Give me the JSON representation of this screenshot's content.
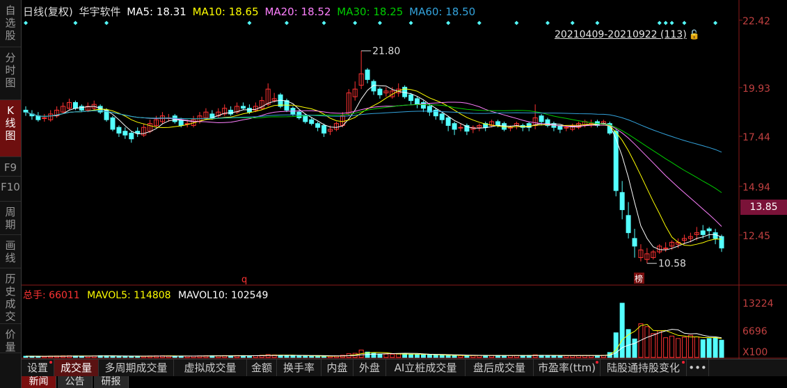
{
  "side_tabs": [
    {
      "label": "自\n选\n股",
      "active": false
    },
    {
      "label": "分\n时\n图",
      "active": false
    },
    {
      "label": "K\n线\n图",
      "active": true
    },
    {
      "label": "F9",
      "active": false
    },
    {
      "label": "F10",
      "active": false
    },
    {
      "label": "周\n期",
      "active": false
    },
    {
      "label": "画\n线",
      "active": false
    },
    {
      "label": "历\n史\n成\n交",
      "active": false
    },
    {
      "label": "价\n量",
      "active": false
    }
  ],
  "legend": {
    "period": "日线(复权)",
    "name": "华宇软件",
    "ma5": "MA5: 18.31",
    "ma10": "MA10: 18.65",
    "ma20": "MA20: 18.52",
    "ma30": "MA30: 18.25",
    "ma60": "MA60: 18.50"
  },
  "colors": {
    "up": "#ff3333",
    "down": "#54ffff",
    "ma5": "#ffffff",
    "ma10": "#ffff00",
    "ma20": "#ff80ff",
    "ma30": "#00cc00",
    "ma60": "#33a3dc"
  },
  "range_label": "20210409-20210922 (113)",
  "price_axis": [
    "22.42",
    "19.93",
    "17.44",
    "14.94",
    "12.45"
  ],
  "current_price": "13.85",
  "annotations": {
    "high": "21.80",
    "low": "10.58",
    "marker_q": "q",
    "marker_bang": "榜"
  },
  "volume_legend": {
    "total": "总手: 66011",
    "mavol5": "MAVOL5: 114808",
    "mavol10": "MAVOL10: 102549"
  },
  "volume_axis": [
    "13224",
    "6696",
    "X100"
  ],
  "bottom_tabs": [
    {
      "label": "设置",
      "dot": true
    },
    {
      "label": "成交量",
      "active": true
    },
    {
      "label": "多周期成交量"
    },
    {
      "label": "虚拟成交量"
    },
    {
      "label": "金额"
    },
    {
      "label": "换手率"
    },
    {
      "label": "内盘"
    },
    {
      "label": "外盘"
    },
    {
      "label": "AI立桩成交量"
    },
    {
      "label": "盘后成交量"
    },
    {
      "label": "市盈率(ttm)",
      "dot": true
    },
    {
      "label": "陆股通持股变化",
      "dot": true
    },
    {
      "label": "•••"
    }
  ],
  "news_tabs": [
    {
      "label": "新闻",
      "active": true
    },
    {
      "label": "公告"
    },
    {
      "label": "研报"
    }
  ],
  "chart_data": {
    "type": "candlestick",
    "y_range": [
      10.0,
      23.0
    ],
    "x": [
      "0",
      "1",
      "2",
      "3",
      "4",
      "5",
      "6",
      "7",
      "8",
      "9",
      "10",
      "11",
      "12",
      "13",
      "14",
      "15",
      "16",
      "17",
      "18",
      "19",
      "20",
      "21",
      "22",
      "23",
      "24",
      "25",
      "26",
      "27",
      "28",
      "29",
      "30",
      "31",
      "32",
      "33",
      "34",
      "35",
      "36",
      "37",
      "38",
      "39",
      "40",
      "41",
      "42",
      "43",
      "44",
      "45",
      "46",
      "47",
      "48",
      "49",
      "50",
      "51",
      "52",
      "53",
      "54",
      "55",
      "56",
      "57",
      "58",
      "59",
      "60",
      "61",
      "62",
      "63",
      "64",
      "65",
      "66",
      "67",
      "68",
      "69",
      "70",
      "71",
      "72",
      "73",
      "74",
      "75",
      "76",
      "77",
      "78",
      "79",
      "80",
      "81",
      "82",
      "83",
      "84",
      "85",
      "86",
      "87",
      "88",
      "89",
      "90",
      "91",
      "92",
      "93",
      "94",
      "95",
      "96",
      "97",
      "98",
      "99",
      "100",
      "101",
      "102",
      "103",
      "104",
      "105",
      "106",
      "107",
      "108",
      "109",
      "110",
      "111",
      "112"
    ],
    "open": [
      18.7,
      18.5,
      18.4,
      18.3,
      18.2,
      18.4,
      18.6,
      18.8,
      19.1,
      18.9,
      18.7,
      18.8,
      18.9,
      18.7,
      18.3,
      17.8,
      17.6,
      17.5,
      17.6,
      17.4,
      17.6,
      17.9,
      18.1,
      18.3,
      18.4,
      18.2,
      18.0,
      17.9,
      18.1,
      18.3,
      18.5,
      18.4,
      18.5,
      18.7,
      18.6,
      18.9,
      18.8,
      18.7,
      18.8,
      19.0,
      19.2,
      19.5,
      19.2,
      18.8,
      18.6,
      18.4,
      18.2,
      18.0,
      17.9,
      17.6,
      17.7,
      17.9,
      18.5,
      19.4,
      20.0,
      20.8,
      20.2,
      19.8,
      19.6,
      19.4,
      19.6,
      19.9,
      19.5,
      19.3,
      19.1,
      18.9,
      18.7,
      18.5,
      18.3,
      18.0,
      17.8,
      17.9,
      17.7,
      17.8,
      18.0,
      17.9,
      18.1,
      18.0,
      17.8,
      17.9,
      17.9,
      18.0,
      17.9,
      18.4,
      18.2,
      18.0,
      17.9,
      17.8,
      17.7,
      17.8,
      17.9,
      18.0,
      18.1,
      18.0,
      18.0,
      17.6,
      14.4,
      13.2,
      12.0,
      11.0,
      10.9,
      11.0,
      11.3,
      11.5,
      11.6,
      11.7,
      11.9,
      12.0,
      12.2,
      12.4,
      12.5,
      12.3,
      12.1
    ],
    "close": [
      18.6,
      18.4,
      18.2,
      18.3,
      18.5,
      18.7,
      18.9,
      19.1,
      18.8,
      18.7,
      18.9,
      19.0,
      18.6,
      18.2,
      17.7,
      17.5,
      17.4,
      17.2,
      17.5,
      17.8,
      18.0,
      18.2,
      18.4,
      18.3,
      18.1,
      17.9,
      18.0,
      18.2,
      18.4,
      18.6,
      18.3,
      18.6,
      18.8,
      18.5,
      18.9,
      18.8,
      18.6,
      18.9,
      19.2,
      19.8,
      19.3,
      18.9,
      18.7,
      18.5,
      18.3,
      18.1,
      18.0,
      17.8,
      17.5,
      17.7,
      18.0,
      18.4,
      19.6,
      19.8,
      20.6,
      20.3,
      19.7,
      19.5,
      19.7,
      19.7,
      19.8,
      19.4,
      19.2,
      19.0,
      18.8,
      18.6,
      18.4,
      18.2,
      17.9,
      17.7,
      17.8,
      17.6,
      17.8,
      17.9,
      17.8,
      18.1,
      17.9,
      17.7,
      17.8,
      18.0,
      17.8,
      17.8,
      18.3,
      18.1,
      17.9,
      17.8,
      17.7,
      17.8,
      17.9,
      18.0,
      18.1,
      18.0,
      17.9,
      18.1,
      17.5,
      14.5,
      13.5,
      12.3,
      11.6,
      11.4,
      11.2,
      11.3,
      11.6,
      11.5,
      11.8,
      11.8,
      12.0,
      12.1,
      12.3,
      12.2,
      12.4,
      12.0,
      11.5
    ],
    "high": [
      18.9,
      18.7,
      18.6,
      18.5,
      18.7,
      18.9,
      19.1,
      19.3,
      19.2,
      19.0,
      19.1,
      19.2,
      19.0,
      18.8,
      18.4,
      17.9,
      17.8,
      17.6,
      17.8,
      18.0,
      18.2,
      18.4,
      18.6,
      18.5,
      18.5,
      18.3,
      18.2,
      18.4,
      18.6,
      18.8,
      18.7,
      18.8,
      19.0,
      18.9,
      19.1,
      19.1,
      19.0,
      19.1,
      19.4,
      20.1,
      19.6,
      19.6,
      19.3,
      18.9,
      18.7,
      18.5,
      18.3,
      18.1,
      18.0,
      17.9,
      18.1,
      18.6,
      19.8,
      20.2,
      21.8,
      20.9,
      20.3,
      19.9,
      19.9,
      19.9,
      20.1,
      20.0,
      19.6,
      19.4,
      19.2,
      19.0,
      18.8,
      18.6,
      18.4,
      18.1,
      18.0,
      18.0,
      17.9,
      18.0,
      18.1,
      18.2,
      18.2,
      18.1,
      17.9,
      18.1,
      18.0,
      18.1,
      19.0,
      18.5,
      18.3,
      18.1,
      17.9,
      17.9,
      18.0,
      18.1,
      18.2,
      18.2,
      18.2,
      18.2,
      18.1,
      17.7,
      15.0,
      13.9,
      12.5,
      11.7,
      11.5,
      11.4,
      11.7,
      11.8,
      11.9,
      12.0,
      12.2,
      12.3,
      12.6,
      12.7,
      12.6,
      12.5,
      12.2
    ],
    "low": [
      18.4,
      18.2,
      18.1,
      18.1,
      18.1,
      18.3,
      18.5,
      18.7,
      18.7,
      18.6,
      18.6,
      18.7,
      18.5,
      18.1,
      17.6,
      17.3,
      17.2,
      17.0,
      17.3,
      17.3,
      17.5,
      17.8,
      18.0,
      18.1,
      18.0,
      17.8,
      17.8,
      17.8,
      18.0,
      18.2,
      18.2,
      18.3,
      18.4,
      18.4,
      18.5,
      18.7,
      18.5,
      18.6,
      18.7,
      18.9,
      19.1,
      18.8,
      18.6,
      18.4,
      18.2,
      18.0,
      17.9,
      17.6,
      17.3,
      17.4,
      17.6,
      17.8,
      18.4,
      19.2,
      19.8,
      20.1,
      19.5,
      19.3,
      19.4,
      19.3,
      19.4,
      19.3,
      19.0,
      18.8,
      18.6,
      18.4,
      18.2,
      18.0,
      17.6,
      17.4,
      17.6,
      17.4,
      17.5,
      17.6,
      17.6,
      17.8,
      17.8,
      17.6,
      17.6,
      17.7,
      17.6,
      17.6,
      17.7,
      17.9,
      17.8,
      17.6,
      17.5,
      17.6,
      17.6,
      17.7,
      17.8,
      17.8,
      17.8,
      17.9,
      17.4,
      14.2,
      13.0,
      12.0,
      11.0,
      10.8,
      10.7,
      10.9,
      11.2,
      11.3,
      11.4,
      11.5,
      11.7,
      11.8,
      11.9,
      12.0,
      12.0,
      11.7,
      11.3
    ],
    "volume": [
      300,
      280,
      260,
      270,
      320,
      350,
      380,
      400,
      360,
      330,
      340,
      370,
      420,
      380,
      340,
      300,
      290,
      260,
      280,
      320,
      360,
      380,
      400,
      370,
      340,
      320,
      330,
      350,
      380,
      400,
      380,
      420,
      450,
      410,
      460,
      430,
      400,
      440,
      520,
      700,
      600,
      520,
      480,
      430,
      400,
      360,
      330,
      300,
      280,
      310,
      380,
      520,
      900,
      1000,
      1800,
      1300,
      1000,
      850,
      800,
      780,
      820,
      900,
      780,
      700,
      650,
      600,
      560,
      520,
      480,
      440,
      470,
      430,
      450,
      480,
      460,
      500,
      470,
      440,
      460,
      480,
      450,
      470,
      620,
      520,
      480,
      440,
      420,
      430,
      460,
      470,
      480,
      460,
      450,
      520,
      1200,
      6000,
      13224,
      6800,
      4500,
      8200,
      7500,
      5800,
      6500,
      4800,
      5200,
      4600,
      4900,
      5400,
      5000,
      4300,
      4600,
      4800,
      4200
    ]
  }
}
